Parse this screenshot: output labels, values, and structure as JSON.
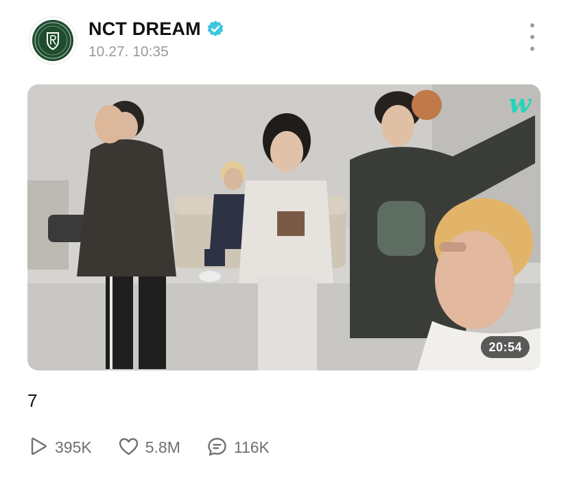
{
  "post": {
    "author": "NCT DREAM",
    "verified": true,
    "timestamp": "10.27. 10:35",
    "caption": "7"
  },
  "video": {
    "duration": "20:54",
    "watermark": "w",
    "watermark_color": "#27d4b8"
  },
  "stats": {
    "plays": "395K",
    "likes": "5.8M",
    "comments": "116K"
  },
  "colors": {
    "verified_badge": "#3ec6e0",
    "avatar_green": "#1e4d2e",
    "secondary_text": "#9a9a9a",
    "stat_text": "#6f6f6f"
  },
  "icons": {
    "play": "play-outline-icon",
    "like": "heart-outline-icon",
    "comment": "comment-bubble-icon",
    "more": "vertical-ellipsis-icon",
    "verified": "verified-check-icon"
  }
}
